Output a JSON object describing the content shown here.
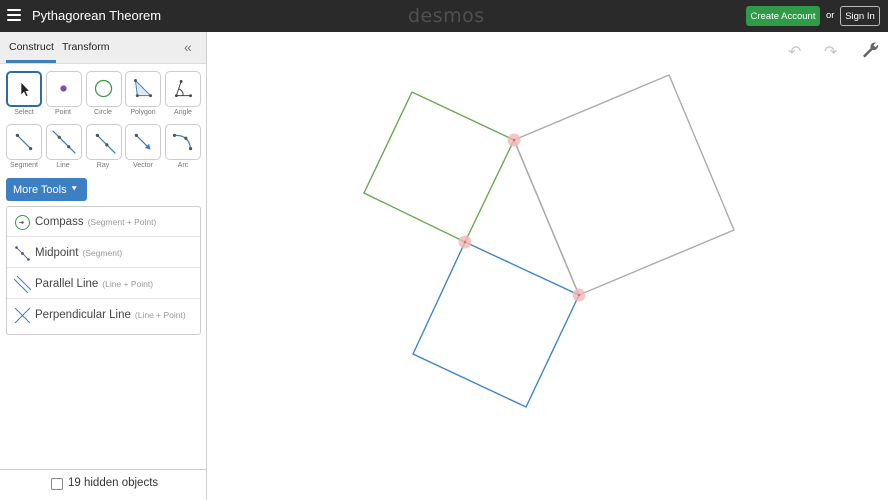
{
  "header": {
    "title": "Pythagorean Theorem",
    "brand": "desmos",
    "create_account": "Create Account",
    "or": "or",
    "sign_in": "Sign In"
  },
  "panel": {
    "tabs": [
      {
        "label": "Construct",
        "active": true
      },
      {
        "label": "Transform",
        "active": false
      }
    ],
    "tools": [
      {
        "label": "Select",
        "icon": "select-arrow-icon"
      },
      {
        "label": "Point",
        "icon": "point-icon"
      },
      {
        "label": "Circle",
        "icon": "circle-icon"
      },
      {
        "label": "Polygon",
        "icon": "polygon-icon"
      },
      {
        "label": "Angle",
        "icon": "angle-icon"
      },
      {
        "label": "Segment",
        "icon": "segment-icon"
      },
      {
        "label": "Line",
        "icon": "line-icon"
      },
      {
        "label": "Ray",
        "icon": "ray-icon"
      },
      {
        "label": "Vector",
        "icon": "vector-icon"
      },
      {
        "label": "Arc",
        "icon": "arc-icon"
      }
    ],
    "more_tools": "More Tools",
    "more_list": [
      {
        "name": "Compass",
        "hint": "(Segment + Point)",
        "icon": "compass-icon"
      },
      {
        "name": "Midpoint",
        "hint": "(Segment)",
        "icon": "midpoint-icon"
      },
      {
        "name": "Parallel Line",
        "hint": "(Line + Point)",
        "icon": "parallel-line-icon"
      },
      {
        "name": "Perpendicular Line",
        "hint": "(Line + Point)",
        "icon": "perpendicular-line-icon"
      }
    ],
    "hidden_objects": "19 hidden objects"
  },
  "canvas": {
    "undo_icon": "undo-icon",
    "redo_icon": "redo-icon",
    "settings_icon": "wrench-icon",
    "colors": {
      "green_square": "#6aa84f",
      "blue_square": "#3d85c6",
      "gray_square": "#aaaaaa",
      "vertex_highlight": "#f4b6b6"
    }
  }
}
